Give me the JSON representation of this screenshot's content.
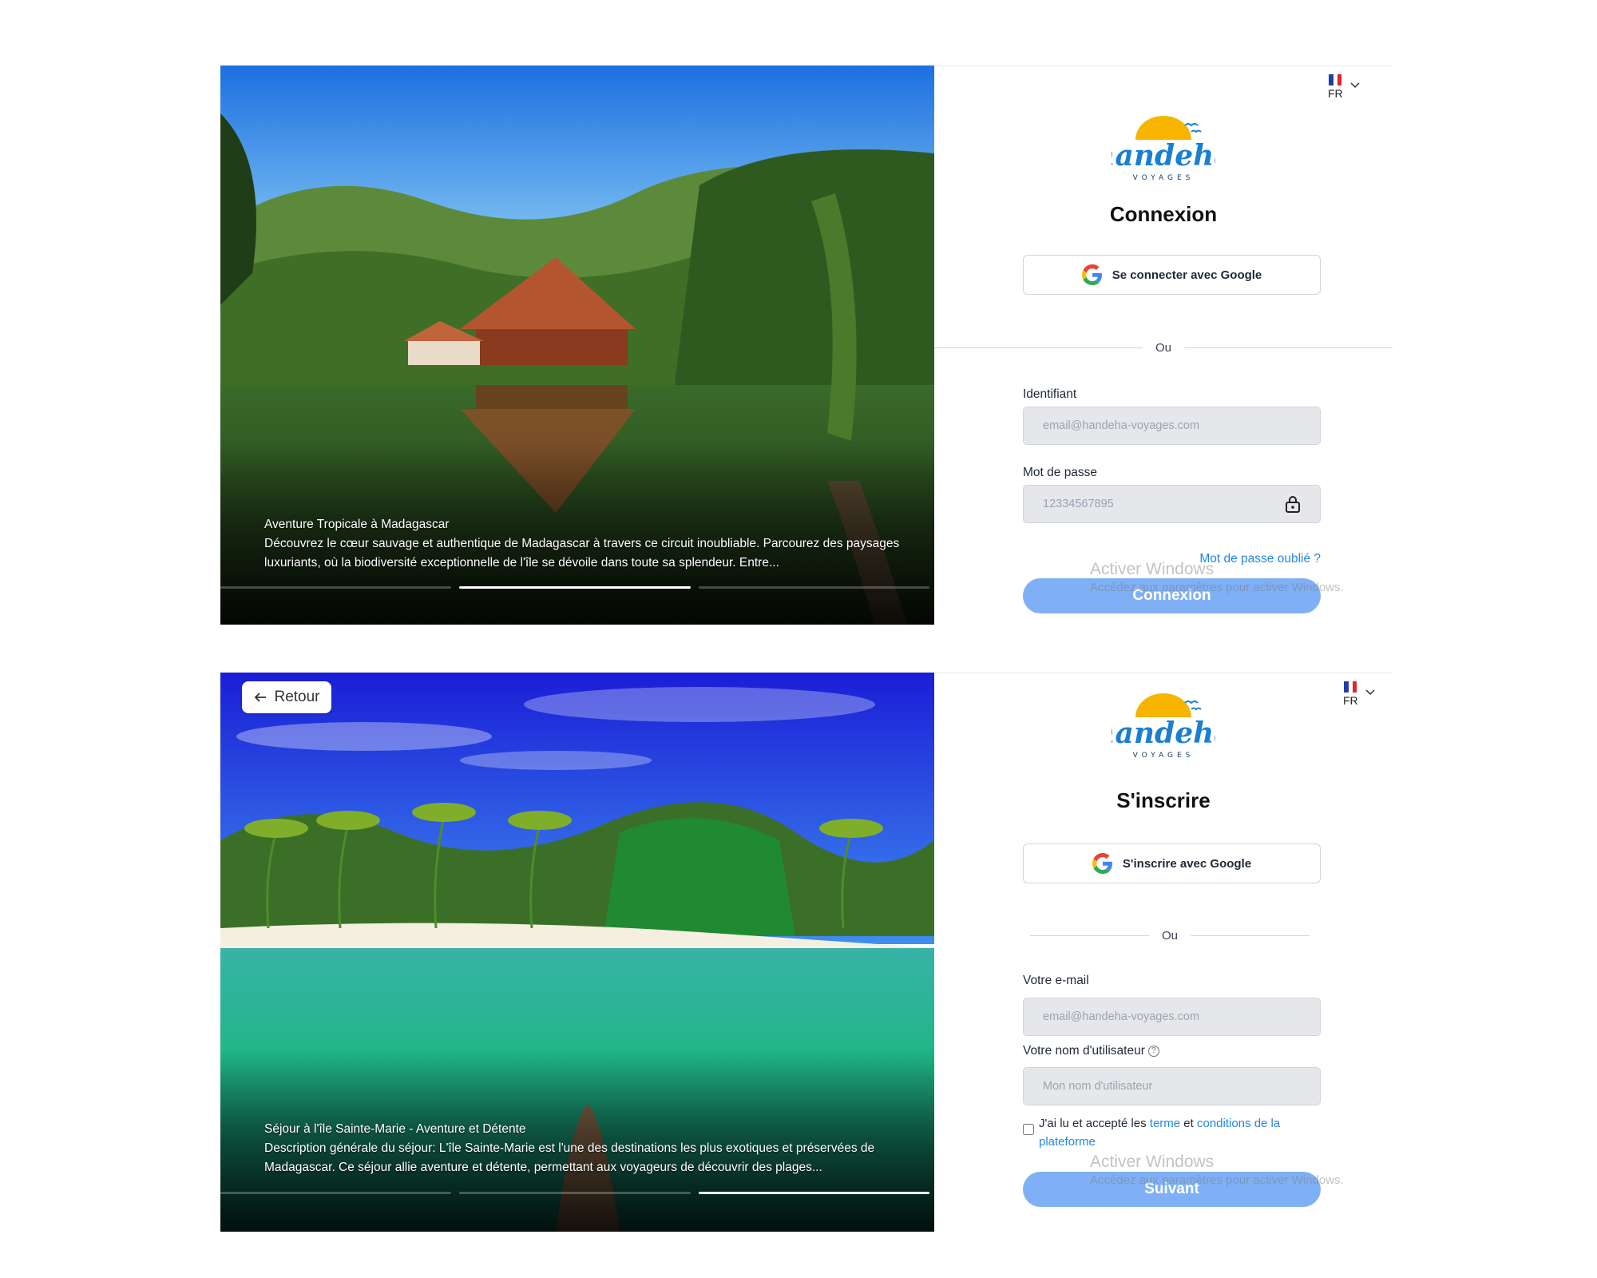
{
  "login": {
    "hero": {
      "title": "Aventure Tropicale à Madagascar",
      "description": "Découvrez le cœur sauvage et authentique de Madagascar à travers ce circuit inoubliable. Parcourez des paysages luxuriants, où la biodiversité exceptionnelle de l'île se dévoile dans toute sa splendeur. Entre...",
      "slides_total": 3,
      "active_slide": 2
    },
    "language": {
      "code": "FR"
    },
    "logo": {
      "brand": "handeha",
      "tagline": "VOYAGES"
    },
    "heading": "Connexion",
    "google_button": "Se connecter avec Google",
    "divider": "Ou",
    "identifier_label": "Identifiant",
    "identifier_placeholder": "email@handeha-voyages.com",
    "password_label": "Mot de passe",
    "password_placeholder": "12334567895",
    "forgot_link": "Mot de passe oublié ?",
    "submit": "Connexion",
    "watermark": {
      "line1": "Activer Windows",
      "line2": "Accédez aux paramètres pour activer Windows."
    }
  },
  "signup": {
    "back_button": "Retour",
    "hero": {
      "title": "Séjour à l'île Sainte-Marie - Aventure et Détente",
      "description": "Description générale du séjour: L'île Sainte-Marie est l'une des destinations les plus exotiques et préservées de Madagascar. Ce séjour allie aventure et détente, permettant aux voyageurs de découvrir des plages...",
      "slides_total": 3,
      "active_slide": 3
    },
    "language": {
      "code": "FR"
    },
    "logo": {
      "brand": "handeha",
      "tagline": "VOYAGES"
    },
    "heading": "S'inscrire",
    "google_button": "S'inscrire avec Google",
    "divider": "Ou",
    "email_label": "Votre e-mail",
    "email_placeholder": "email@handeha-voyages.com",
    "username_label": "Votre nom d'utilisateur",
    "username_placeholder": "Mon nom d'utilisateur",
    "terms": {
      "prefix": "J'ai lu et accepté les",
      "link1": "terme",
      "middle": "et",
      "link2": "conditions de la plateforme",
      "checked": false
    },
    "submit": "Suivant",
    "watermark": {
      "line1": "Activer Windows",
      "line2": "Accédez aux paramètres pour activer Windows."
    }
  },
  "colors": {
    "primary_button": "#7fb0f5",
    "link": "#2386e8",
    "input_bg": "#e5e7eb",
    "logo_blue": "#1a7fd1",
    "logo_sun": "#f7b500"
  },
  "icons": {
    "google": "google-g-icon",
    "lock": "lock-icon",
    "chevron": "chevron-down-icon",
    "flag": "france-flag-icon",
    "back": "arrow-left-icon"
  }
}
